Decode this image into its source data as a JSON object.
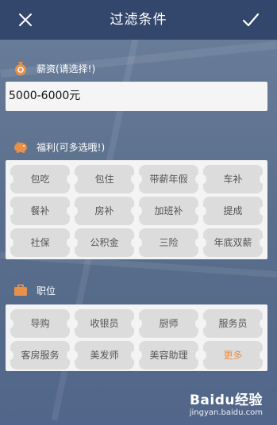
{
  "header": {
    "title": "过滤条件"
  },
  "salary": {
    "label": "薪资(请选择!)",
    "value": "5000-6000元"
  },
  "benefits": {
    "label": "福利(可多选哦!)",
    "items": [
      "包吃",
      "包住",
      "带薪年假",
      "车补",
      "餐补",
      "房补",
      "加班补",
      "提成",
      "社保",
      "公积金",
      "三险",
      "年底双薪"
    ]
  },
  "positions": {
    "label": "职位",
    "items": [
      "导购",
      "收银员",
      "厨师",
      "服务员",
      "客房服务",
      "美发师",
      "美容助理"
    ],
    "more_label": "更多"
  },
  "watermark": {
    "logo": "Baidu经验",
    "url": "jingyan.baidu.com"
  },
  "colors": {
    "topbar": "#33466b",
    "accent": "#e8914a",
    "chip": "#dcdcdc"
  }
}
